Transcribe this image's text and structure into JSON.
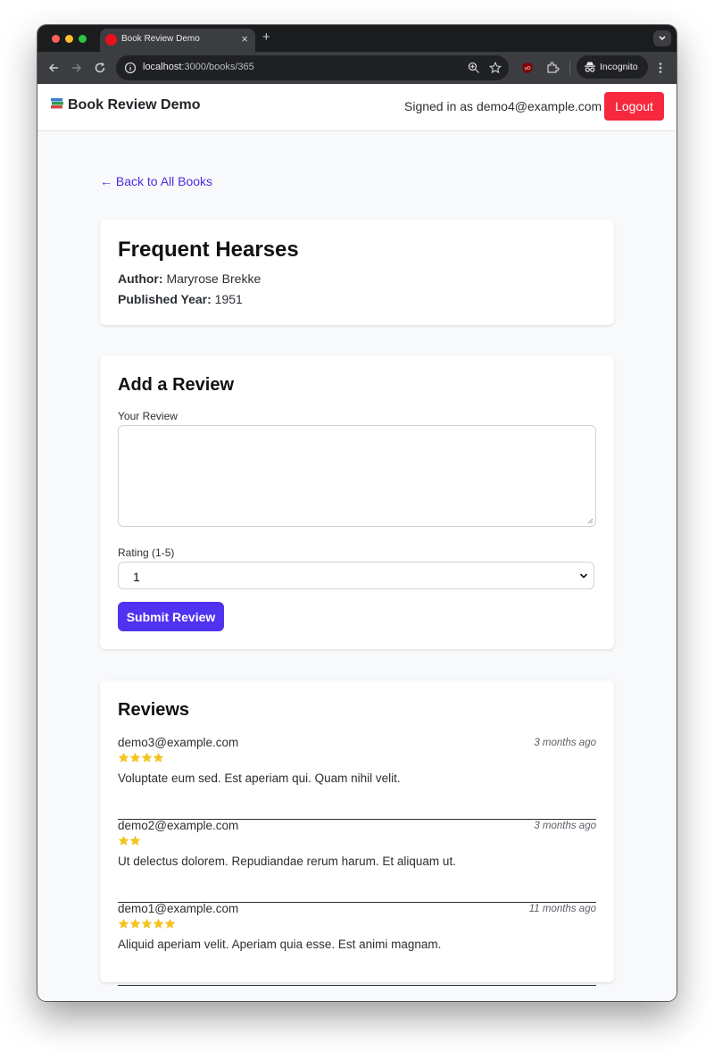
{
  "browser": {
    "tab_title": "Book Review Demo",
    "url_host": "localhost",
    "url_path": ":3000/books/365",
    "incognito_label": "Incognito"
  },
  "navbar": {
    "brand": "Book Review Demo",
    "brand_icon": "books-icon",
    "signed_in": "Signed in as demo4@example.com",
    "logout": "Logout"
  },
  "back_link": "← Back to All Books",
  "book": {
    "title": "Frequent Hearses",
    "author_label": "Author:",
    "author": "Maryrose Brekke",
    "year_label": "Published Year:",
    "year": "1951"
  },
  "review_form": {
    "heading": "Add a Review",
    "review_label": "Your Review",
    "review_value": "",
    "rating_label": "Rating (1-5)",
    "rating_value": "1",
    "submit": "Submit Review"
  },
  "reviews": {
    "heading": "Reviews",
    "items": [
      {
        "user": "demo3@example.com",
        "time": "3 months ago",
        "stars": 4,
        "body": "Voluptate eum sed. Est aperiam qui. Quam nihil velit."
      },
      {
        "user": "demo2@example.com",
        "time": "3 months ago",
        "stars": 2,
        "body": "Ut delectus dolorem. Repudiandae rerum harum. Et aliquam ut."
      },
      {
        "user": "demo1@example.com",
        "time": "11 months ago",
        "stars": 5,
        "body": "Aliquid aperiam velit. Aperiam quia esse. Est animi magnam."
      }
    ]
  },
  "colors": {
    "star": "#f4c321",
    "accent": "#4f33f0",
    "logout": "#f5283e",
    "link": "#4b2fe0"
  }
}
